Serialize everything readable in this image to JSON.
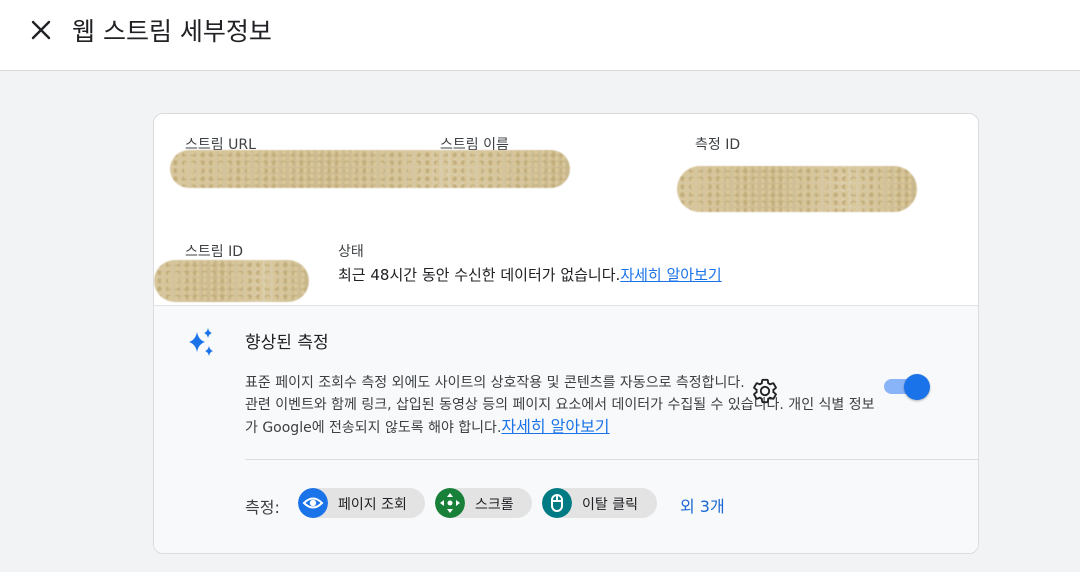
{
  "header": {
    "title": "웹 스트림 세부정보",
    "close_icon": "close-icon"
  },
  "stream_details": {
    "url_label": "스트림 URL",
    "name_label": "스트림 이름",
    "measurement_id_label": "측정 ID",
    "stream_id_label": "스트림 ID",
    "status_label": "상태",
    "status_text": "최근 48시간 동안 수신한 데이터가 없습니다.",
    "status_link": "자세히 알아보기"
  },
  "enhanced_measurement": {
    "title": "향상된 측정",
    "description": "표준 페이지 조회수 측정 외에도 사이트의 상호작용 및 콘텐츠를 자동으로 측정합니다.\n관련 이벤트와 함께 링크, 삽입된 동영상 등의 페이지 요소에서 데이터가 수집될 수 있습니다. 개인 식별 정보가 Google에 전송되지 않도록 해야 합니다.",
    "link": "자세히 알아보기",
    "toggle_on": true,
    "measuring_label": "측정:",
    "chips": [
      {
        "label": "페이지 조회",
        "icon": "eye-icon",
        "color": "#1a73e8"
      },
      {
        "label": "스크롤",
        "icon": "scroll-arrows-icon",
        "color": "#188038"
      },
      {
        "label": "이탈 클릭",
        "icon": "mouse-icon",
        "color": "#007b83"
      }
    ],
    "more_label": "외 3개"
  },
  "colors": {
    "accent": "#1a73e8",
    "toggle_track": "#8ab4f8",
    "panel_bg": "#f8f9fa",
    "page_bg": "#f1f3f4"
  }
}
